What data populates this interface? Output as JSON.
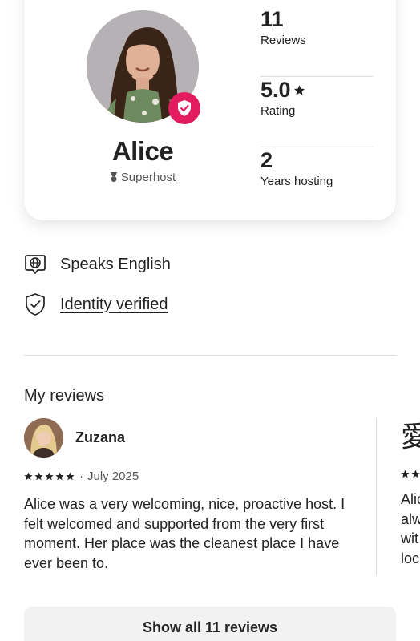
{
  "host": {
    "name": "Alice",
    "superhost_label": "Superhost"
  },
  "stats": [
    {
      "value": "11",
      "label": "Reviews"
    },
    {
      "value": "5.0",
      "label": "Rating",
      "icon": "star-icon"
    },
    {
      "value": "2",
      "label": "Years hosting"
    }
  ],
  "info": {
    "languages": "Speaks English",
    "identity": "Identity verified"
  },
  "reviews_section": {
    "title": "My reviews",
    "reviews": [
      {
        "reviewer": "Zuzana",
        "rating": 5,
        "date": "July 2025",
        "separator": "·",
        "text": "Alice was a very welcoming, nice, proactive host. I felt welcomed and supported from the very first moment. Her place was the cleanest place I have ever been to."
      }
    ],
    "peek": {
      "avatar_glyph": "愛",
      "lines": [
        "Alic",
        "alw",
        "wit",
        "loc"
      ]
    },
    "show_all_label": "Show all 11 reviews"
  },
  "colors": {
    "brand": "#e31c5f",
    "text": "#222222",
    "muted": "#555555",
    "divider": "#dddddd",
    "button_bg": "#f2f2f2"
  }
}
